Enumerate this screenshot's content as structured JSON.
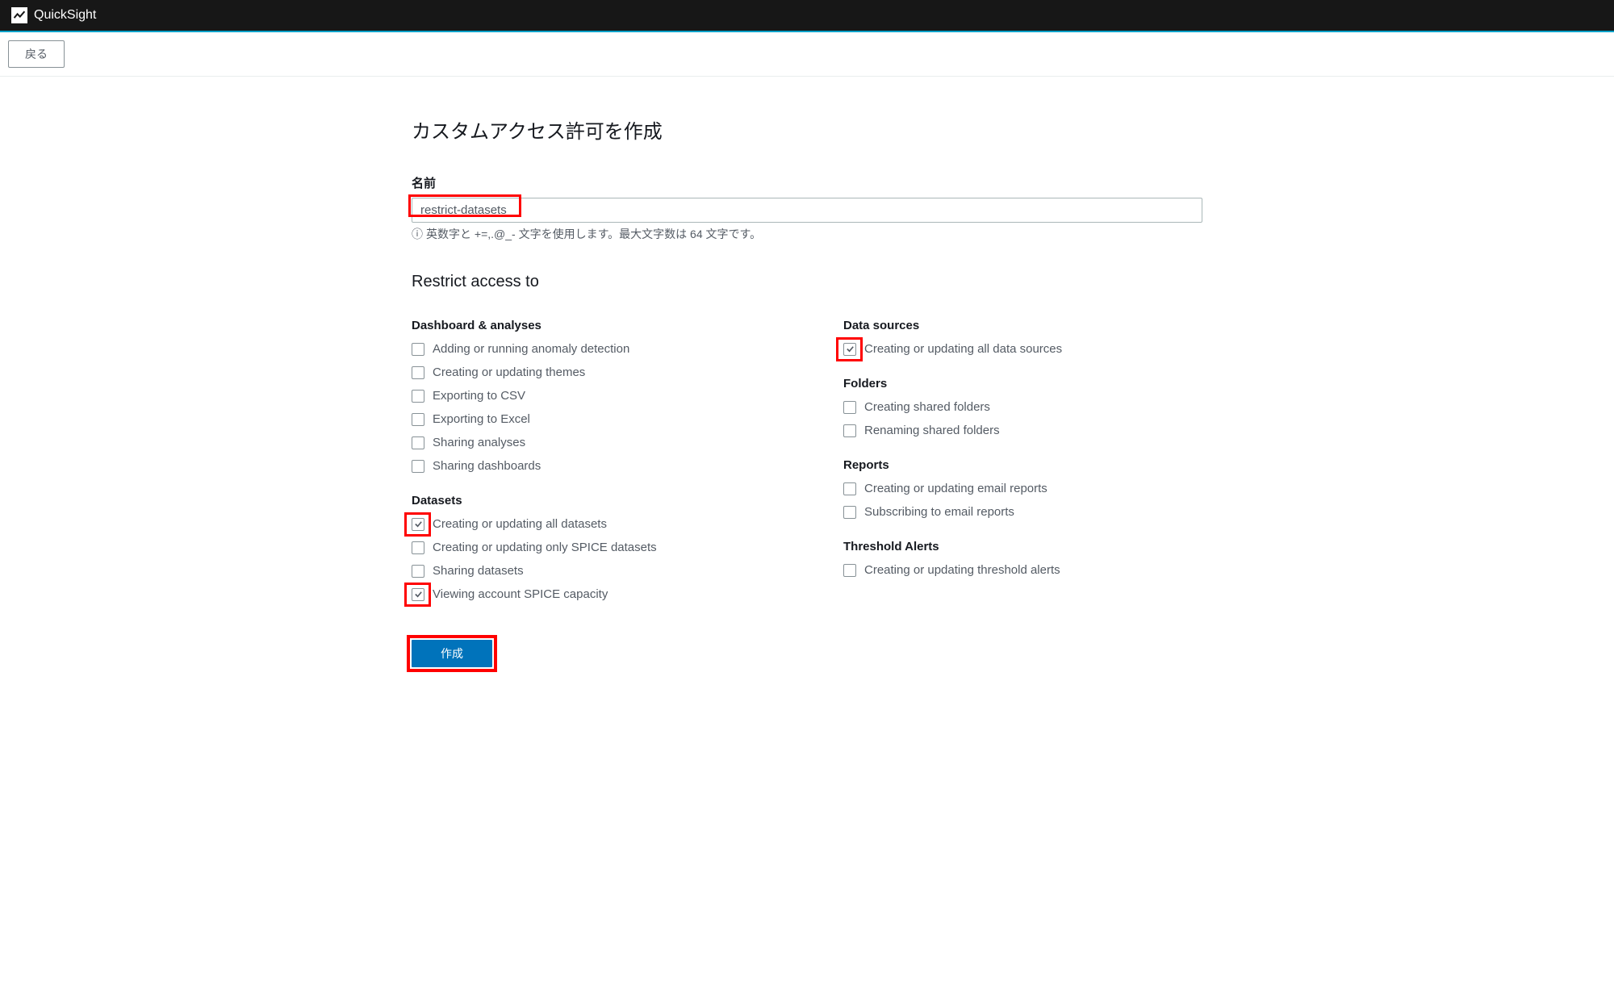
{
  "header": {
    "brand": "QuickSight",
    "back_label": "戻る"
  },
  "page": {
    "title": "カスタムアクセス許可を作成",
    "name_label": "名前",
    "name_value": "restrict-datasets",
    "name_helper": "英数字と +=,.@_- 文字を使用します。最大文字数は 64 文字です。",
    "restrict_title": "Restrict access to",
    "create_button": "作成"
  },
  "groups_left": [
    {
      "title": "Dashboard & analyses",
      "items": [
        {
          "label": "Adding or running anomaly detection",
          "checked": false,
          "highlighted": false
        },
        {
          "label": "Creating or updating themes",
          "checked": false,
          "highlighted": false
        },
        {
          "label": "Exporting to CSV",
          "checked": false,
          "highlighted": false
        },
        {
          "label": "Exporting to Excel",
          "checked": false,
          "highlighted": false
        },
        {
          "label": "Sharing analyses",
          "checked": false,
          "highlighted": false
        },
        {
          "label": "Sharing dashboards",
          "checked": false,
          "highlighted": false
        }
      ]
    },
    {
      "title": "Datasets",
      "items": [
        {
          "label": "Creating or updating all datasets",
          "checked": true,
          "highlighted": true
        },
        {
          "label": "Creating or updating only SPICE datasets",
          "checked": false,
          "highlighted": false
        },
        {
          "label": "Sharing datasets",
          "checked": false,
          "highlighted": false
        },
        {
          "label": "Viewing account SPICE capacity",
          "checked": true,
          "highlighted": true
        }
      ]
    }
  ],
  "groups_right": [
    {
      "title": "Data sources",
      "items": [
        {
          "label": "Creating or updating all data sources",
          "checked": true,
          "highlighted": true
        }
      ]
    },
    {
      "title": "Folders",
      "items": [
        {
          "label": "Creating shared folders",
          "checked": false,
          "highlighted": false
        },
        {
          "label": "Renaming shared folders",
          "checked": false,
          "highlighted": false
        }
      ]
    },
    {
      "title": "Reports",
      "items": [
        {
          "label": "Creating or updating email reports",
          "checked": false,
          "highlighted": false
        },
        {
          "label": "Subscribing to email reports",
          "checked": false,
          "highlighted": false
        }
      ]
    },
    {
      "title": "Threshold Alerts",
      "items": [
        {
          "label": "Creating or updating threshold alerts",
          "checked": false,
          "highlighted": false
        }
      ]
    }
  ]
}
